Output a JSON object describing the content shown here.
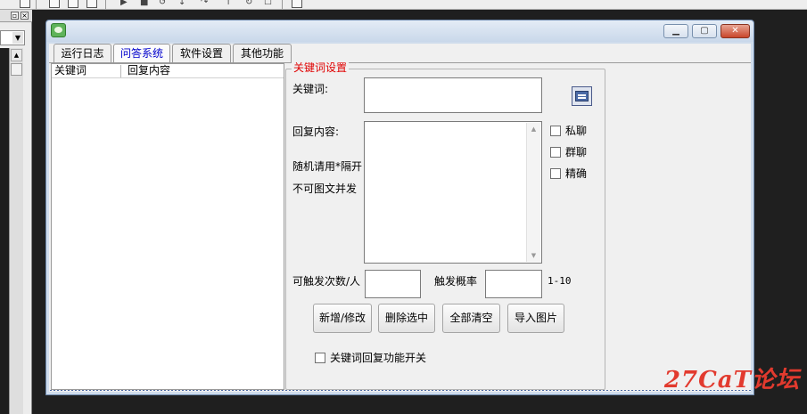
{
  "app": {
    "tabs": [
      {
        "label": "运行日志",
        "active": false
      },
      {
        "label": "问答系统",
        "active": true
      },
      {
        "label": "软件设置",
        "active": false
      },
      {
        "label": "其他功能",
        "active": false
      }
    ]
  },
  "list": {
    "columns": [
      "关键词",
      "回复内容"
    ],
    "rows": []
  },
  "settings": {
    "group_title": "关键词设置",
    "keyword_label": "关键词:",
    "keyword_value": "",
    "reply_label": "回复内容:",
    "random_hint": "随机请用*隔开",
    "no_image_hint": "不可图文并发",
    "reply_value": "",
    "checkboxes": [
      {
        "label": "私聊",
        "checked": false
      },
      {
        "label": "群聊",
        "checked": false
      },
      {
        "label": "精确",
        "checked": false
      }
    ],
    "trigger_count_label": "可触发次数/人",
    "trigger_count_value": "",
    "trigger_prob_label": "触发概率",
    "trigger_prob_value": "",
    "prob_range_hint": "1-10",
    "buttons": {
      "add_edit": "新增/修改",
      "delete_selected": "删除选中",
      "clear_all": "全部清空",
      "import_image": "导入图片"
    },
    "feature_switch_label": "关键词回复功能开关",
    "feature_switch_checked": false
  },
  "watermark": "27CaT论坛",
  "colors": {
    "group_title": "#e00000",
    "active_tab": "#0000cc",
    "watermark": "#e23a2e",
    "window_frame": "#6e89ad"
  },
  "icons": {
    "app_icon": "green-chat-icon",
    "keyword_picker": "window-icon",
    "minimize": "minimize-icon",
    "maximize": "maximize-icon",
    "close": "close-icon"
  }
}
